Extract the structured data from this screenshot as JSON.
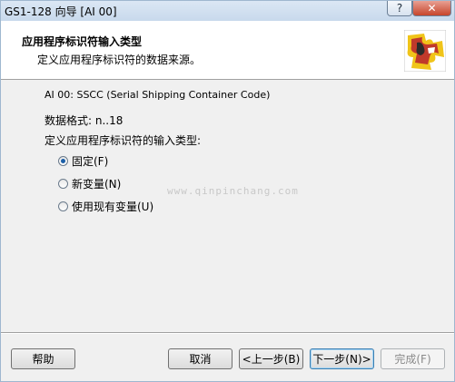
{
  "window": {
    "title": "GS1-128 向导    [AI 00]",
    "help_label": "?",
    "close_label": "✕"
  },
  "header": {
    "title": "应用程序标识符输入类型",
    "subtitle": "定义应用程序标识符的数据来源。",
    "logo_icon": "puzzle-icon"
  },
  "content": {
    "ai_label": "AI 00: SSCC (Serial Shipping Container Code)",
    "data_format": "数据格式: n..18",
    "input_type_prompt": "定义应用程序标识符的输入类型:",
    "options": [
      {
        "label": "固定(F)",
        "checked": true
      },
      {
        "label": "新变量(N)",
        "checked": false
      },
      {
        "label": "使用现有变量(U)",
        "checked": false
      }
    ]
  },
  "watermark": "www.qinpinchang.com",
  "buttons": {
    "help": "帮助",
    "cancel": "取消",
    "back": "<上一步(B)",
    "next": "下一步(N)>",
    "finish": "完成(F)"
  },
  "colors": {
    "radio_dot": "#1c5fa8",
    "close_button": "#c7452b",
    "logo_red": "#c0392b",
    "logo_yellow": "#f0c419"
  }
}
